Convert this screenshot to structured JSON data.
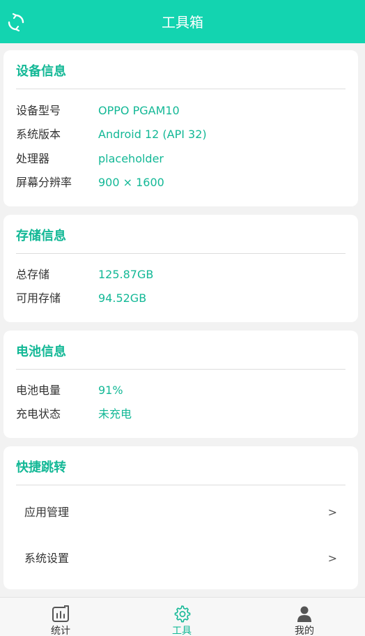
{
  "header": {
    "title": "工具箱",
    "refresh_icon": "refresh-icon",
    "bg_color": "#13d4b0"
  },
  "device": {
    "title": "设备信息",
    "rows": [
      {
        "label": "设备型号",
        "value": "OPPO PGAM10"
      },
      {
        "label": "系统版本",
        "value": "Android 12 (API 32)"
      },
      {
        "label": "处理器",
        "value": "placeholder"
      },
      {
        "label": "屏幕分辨率",
        "value": "900 × 1600"
      }
    ]
  },
  "storage": {
    "title": "存储信息",
    "rows": [
      {
        "label": "总存储",
        "value": "125.87GB"
      },
      {
        "label": "可用存储",
        "value": "94.52GB"
      }
    ]
  },
  "battery": {
    "title": "电池信息",
    "rows": [
      {
        "label": "电池电量",
        "value": "91%"
      },
      {
        "label": "充电状态",
        "value": "未充电"
      }
    ]
  },
  "shortcuts": {
    "title": "快捷跳转",
    "items": [
      {
        "label": "应用管理",
        "chevron": ">"
      },
      {
        "label": "系统设置",
        "chevron": ">"
      }
    ]
  },
  "tabbar": {
    "tabs": [
      {
        "label": "统计",
        "icon": "chart-icon",
        "active": false
      },
      {
        "label": "工具",
        "icon": "gear-icon",
        "active": true
      },
      {
        "label": "我的",
        "icon": "user-icon",
        "active": false
      }
    ]
  },
  "colors": {
    "accent": "#13d4b0",
    "value_text": "#13b896",
    "background": "#f2f2f2"
  }
}
